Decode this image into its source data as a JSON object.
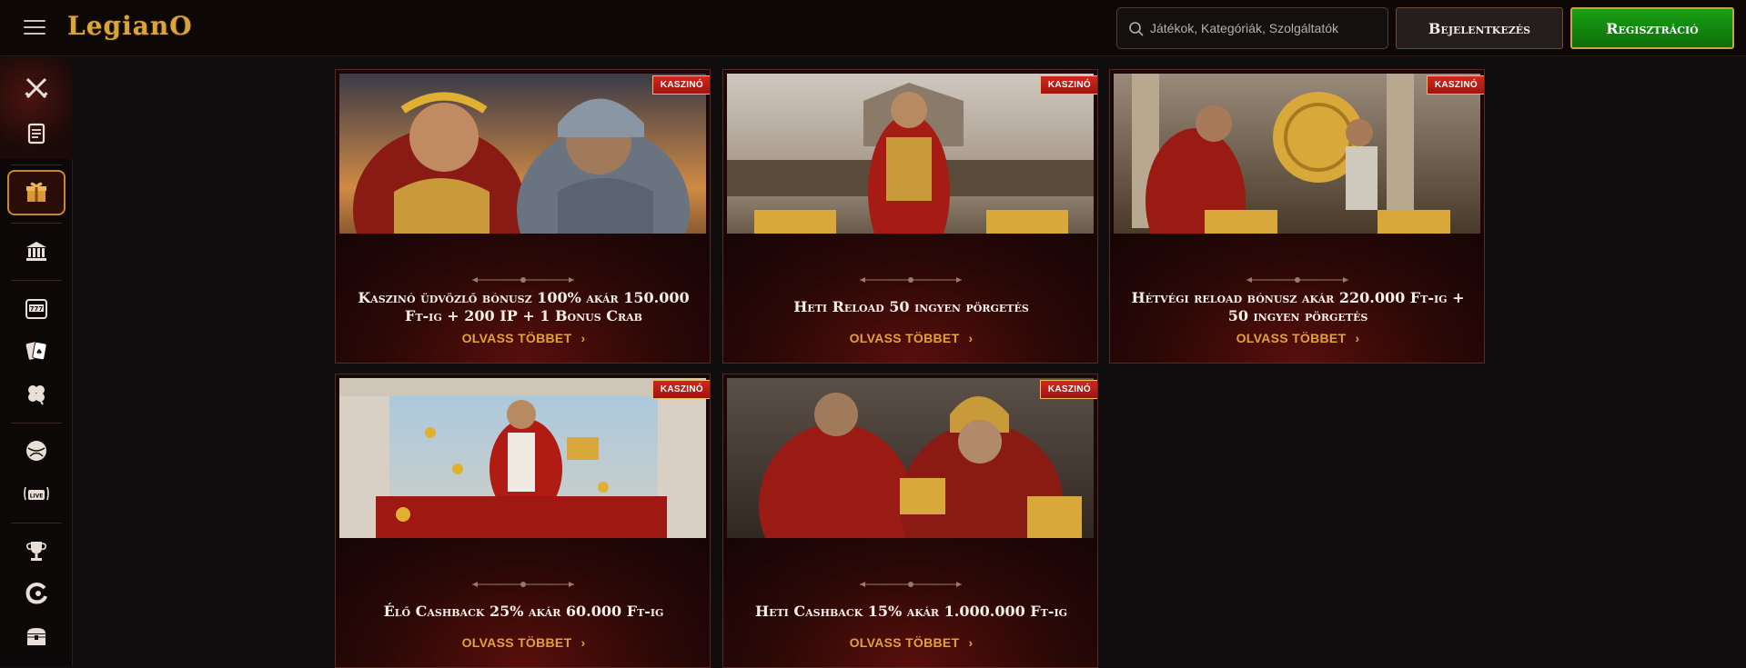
{
  "header": {
    "logo": "LegianO",
    "search_placeholder": "Játékok, Kategóriák, Szolgáltatók",
    "login_label": "Bejelentkezés",
    "register_label": "Regisztráció"
  },
  "sidebar": {
    "icons": [
      "crossed-swords-icon",
      "scroll-icon",
      "gift-icon",
      "bank-icon",
      "slot-machine-icon",
      "playing-cards-icon",
      "clover-icon",
      "sports-ball-icon",
      "live-icon",
      "trophy-icon",
      "logo-c-icon",
      "treasure-chest-icon"
    ]
  },
  "promos": [
    {
      "badge": "KASZINÓ",
      "title": "Kaszinó üdvözlő bónusz 100% akár 150.000 Ft-ig + 200 IP + 1 Bonus Crab",
      "more": "OLVASS TÖBBET"
    },
    {
      "badge": "KASZINÓ",
      "title": "Heti Reload 50 ingyen pörgetés",
      "more": "OLVASS TÖBBET"
    },
    {
      "badge": "KASZINÓ",
      "title": "Hétvégi reload bónusz akár 220.000 Ft-ig + 50 ingyen pörgetés",
      "more": "OLVASS TÖBBET"
    },
    {
      "badge": "KASZINÓ",
      "title": "Élő Cashback 25% akár 60.000 Ft-ig",
      "more": "OLVASS TÖBBET"
    },
    {
      "badge": "KASZINÓ",
      "title": "Heti Cashback 15% akár 1.000.000 Ft-ig",
      "more": "OLVASS TÖBBET"
    }
  ],
  "colors": {
    "accent_gold": "#e3a13a",
    "register_green": "#19a014",
    "badge_red": "#d3261c"
  }
}
